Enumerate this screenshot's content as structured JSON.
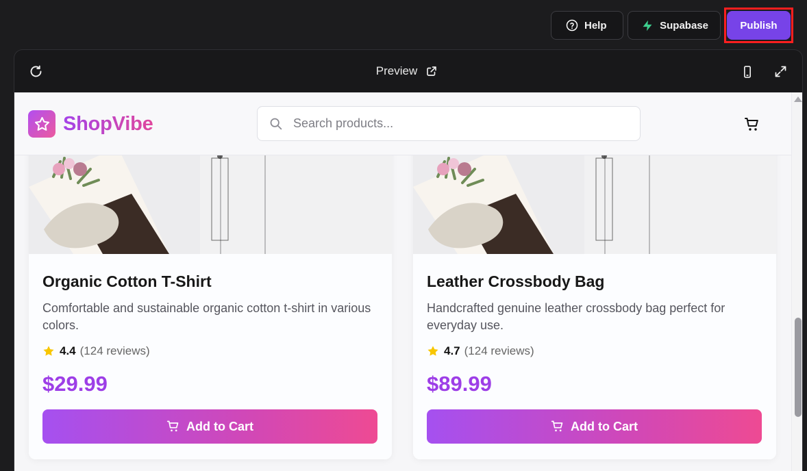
{
  "top_actions": {
    "help_label": "Help",
    "supabase_label": "Supabase",
    "publish_label": "Publish"
  },
  "preview": {
    "title": "Preview"
  },
  "app": {
    "brand": "ShopVibe",
    "search_placeholder": "Search products..."
  },
  "products": [
    {
      "title": "Organic Cotton T-Shirt",
      "description": "Comfortable and sustainable organic cotton t-shirt in various colors.",
      "rating": "4.4",
      "reviews": "(124 reviews)",
      "price": "$29.99",
      "button_label": "Add to Cart"
    },
    {
      "title": "Leather Crossbody Bag",
      "description": "Handcrafted genuine leather crossbody bag perfect for everyday use.",
      "rating": "4.7",
      "reviews": "(124 reviews)",
      "price": "$89.99",
      "button_label": "Add to Cart"
    }
  ],
  "colors": {
    "publish": "#7743e8",
    "brand_gradient_start": "#a443e8",
    "brand_gradient_end": "#e0479c",
    "price": "#9d3ee7"
  }
}
